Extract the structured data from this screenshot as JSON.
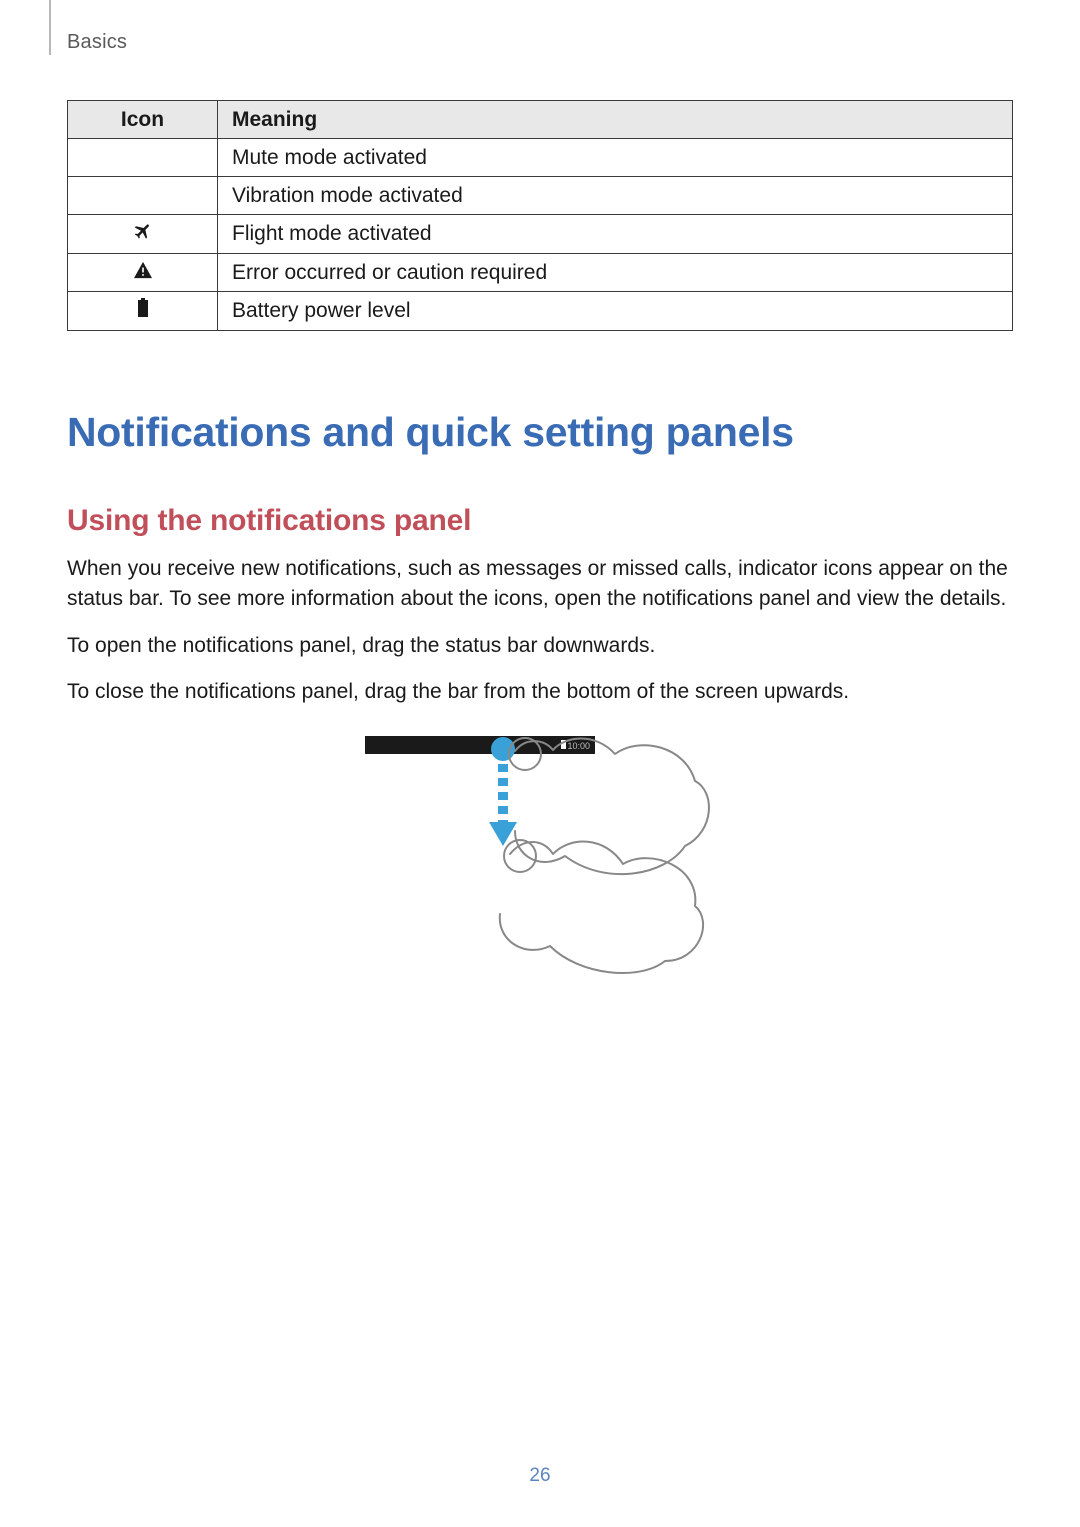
{
  "header": {
    "section": "Basics"
  },
  "table": {
    "columns": [
      "Icon",
      "Meaning"
    ],
    "rows": [
      {
        "icon": "",
        "meaning": "Mute mode activated"
      },
      {
        "icon": "",
        "meaning": "Vibration mode activated"
      },
      {
        "icon": "airplane",
        "meaning": "Flight mode activated"
      },
      {
        "icon": "warning",
        "meaning": "Error occurred or caution required"
      },
      {
        "icon": "battery",
        "meaning": "Battery power level"
      }
    ]
  },
  "headings": {
    "h1": "Notifications and quick setting panels",
    "h2": "Using the notifications panel"
  },
  "paragraphs": {
    "p1": "When you receive new notifications, such as messages or missed calls, indicator icons appear on the status bar. To see more information about the icons, open the notifications panel and view the details.",
    "p2": "To open the notifications panel, drag the status bar downwards.",
    "p3": "To close the notifications panel, drag the bar from the bottom of the screen upwards."
  },
  "illustration": {
    "name": "swipe-down-gesture",
    "status_time": "10:00"
  },
  "page_number": "26"
}
